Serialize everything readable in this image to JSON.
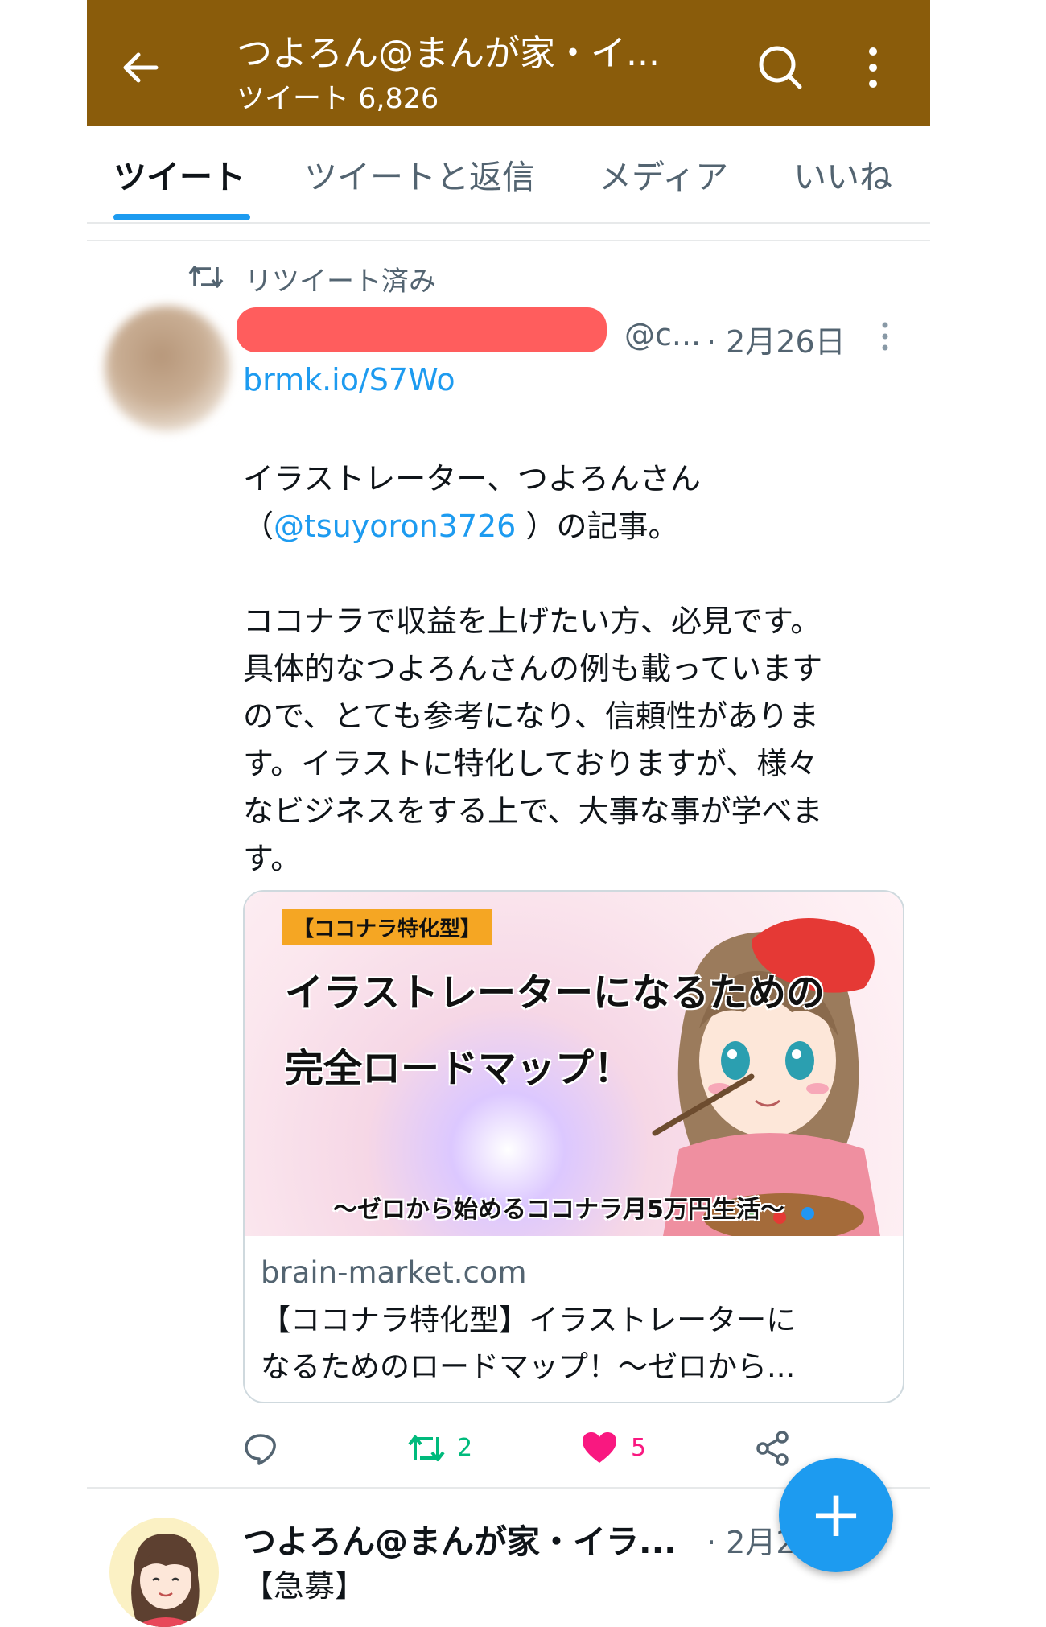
{
  "header": {
    "title": "つよろん@まんが家・イ...",
    "subtitle": "ツイート 6,826",
    "background": "#8a5c0b"
  },
  "tabs": [
    {
      "label": "ツイート",
      "active": true
    },
    {
      "label": "ツイートと返信",
      "active": false
    },
    {
      "label": "メディア",
      "active": false
    },
    {
      "label": "いいね",
      "active": false
    }
  ],
  "tweet1": {
    "retweet_label": "リツイート済み",
    "handle": "@c...",
    "date": "· 2月26日",
    "link": "brmk.io/S7Wo",
    "body": {
      "line1": "イラストレーター、つよろんさん",
      "line2_open": "（",
      "mention": "@tsuyoron3726",
      "line2_close": " ）の記事。",
      "para2": [
        "ココナラで収益を上げたい方、必見です。",
        "具体的なつよろんさんの例も載っています",
        "ので、とても参考になり、信頼性がありま",
        "す。イラストに特化しておりますが、様々",
        "なビジネスをする上で、大事な事が学べま",
        "す。"
      ]
    },
    "card": {
      "image_tag": "【ココナラ特化型】",
      "image_heading1": "イラストレーターになるための",
      "image_heading2": "完全ロードマップ！",
      "image_sub": "〜ゼロから始めるココナラ月5万円生活〜",
      "domain": "brain-market.com",
      "title_line1": "【ココナラ特化型】イラストレーターに",
      "title_line2": "なるためのロードマップ！〜ゼロから..."
    },
    "actions": {
      "reply_count": "",
      "retweet_count": "2",
      "like_count": "5",
      "retweet_color": "#00ba7c",
      "like_color": "#f91880"
    }
  },
  "tweet2": {
    "name": "つよろん@まんが家・イラ...",
    "date": "· 2月2",
    "body": "【急募】"
  },
  "fab": {
    "label": "+",
    "color": "#1d9bf0"
  }
}
